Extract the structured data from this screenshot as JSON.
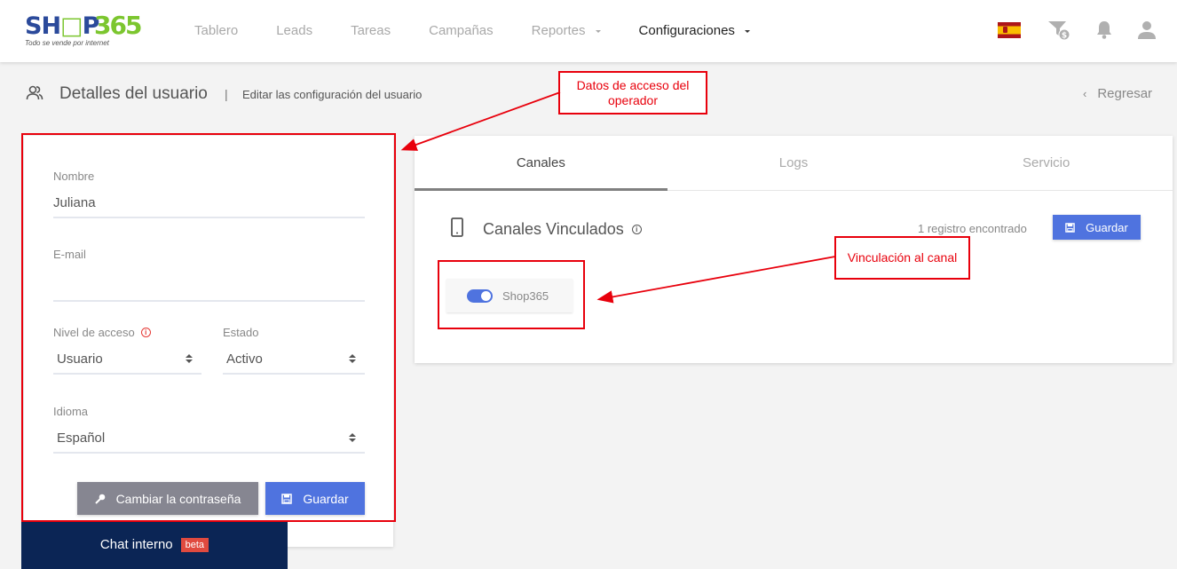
{
  "brand": {
    "name_part1": "SH",
    "name_part2": "P",
    "name_number": "365",
    "tagline": "Todo se vende por internet"
  },
  "nav": {
    "items": [
      {
        "label": "Tablero",
        "active": false,
        "dropdown": false
      },
      {
        "label": "Leads",
        "active": false,
        "dropdown": false
      },
      {
        "label": "Tareas",
        "active": false,
        "dropdown": false
      },
      {
        "label": "Campañas",
        "active": false,
        "dropdown": false
      },
      {
        "label": "Reportes",
        "active": false,
        "dropdown": true
      },
      {
        "label": "Configuraciones",
        "active": true,
        "dropdown": true
      }
    ],
    "icons": [
      "spain-flag-icon",
      "funnel-dollar-icon",
      "bell-icon",
      "user-icon"
    ]
  },
  "page_header": {
    "title": "Detalles del usuario",
    "separator": "|",
    "subtitle": "Editar las configuración del usuario",
    "back_label": "Regresar"
  },
  "user_form": {
    "name": {
      "label": "Nombre",
      "value": "Juliana"
    },
    "email": {
      "label": "E-mail",
      "value": ""
    },
    "access_level": {
      "label": "Nivel de acceso",
      "value": "Usuario"
    },
    "status": {
      "label": "Estado",
      "value": "Activo"
    },
    "language": {
      "label": "Idioma",
      "value": "Español"
    },
    "change_password_label": "Cambiar la contraseña",
    "save_label": "Guardar"
  },
  "details_panel": {
    "tabs": [
      {
        "label": "Canales",
        "active": true
      },
      {
        "label": "Logs",
        "active": false
      },
      {
        "label": "Servicio",
        "active": false
      }
    ],
    "section_title": "Canales Vinculados",
    "record_count": "1 registro encontrado",
    "save_label": "Guardar",
    "channels": [
      {
        "name": "Shop365",
        "enabled": true
      }
    ]
  },
  "chat": {
    "label": "Chat interno",
    "badge": "beta"
  },
  "annotations": {
    "operator_access": "Datos de acceso del operador",
    "channel_link": "Vinculación al canal"
  },
  "colors": {
    "accent_blue": "#4f73df",
    "chat_navy": "#0b2555",
    "beta_red": "#e04a3f",
    "annotation_red": "#e8000c",
    "logo_blue": "#2b4a9b",
    "logo_green": "#7cc62f"
  }
}
